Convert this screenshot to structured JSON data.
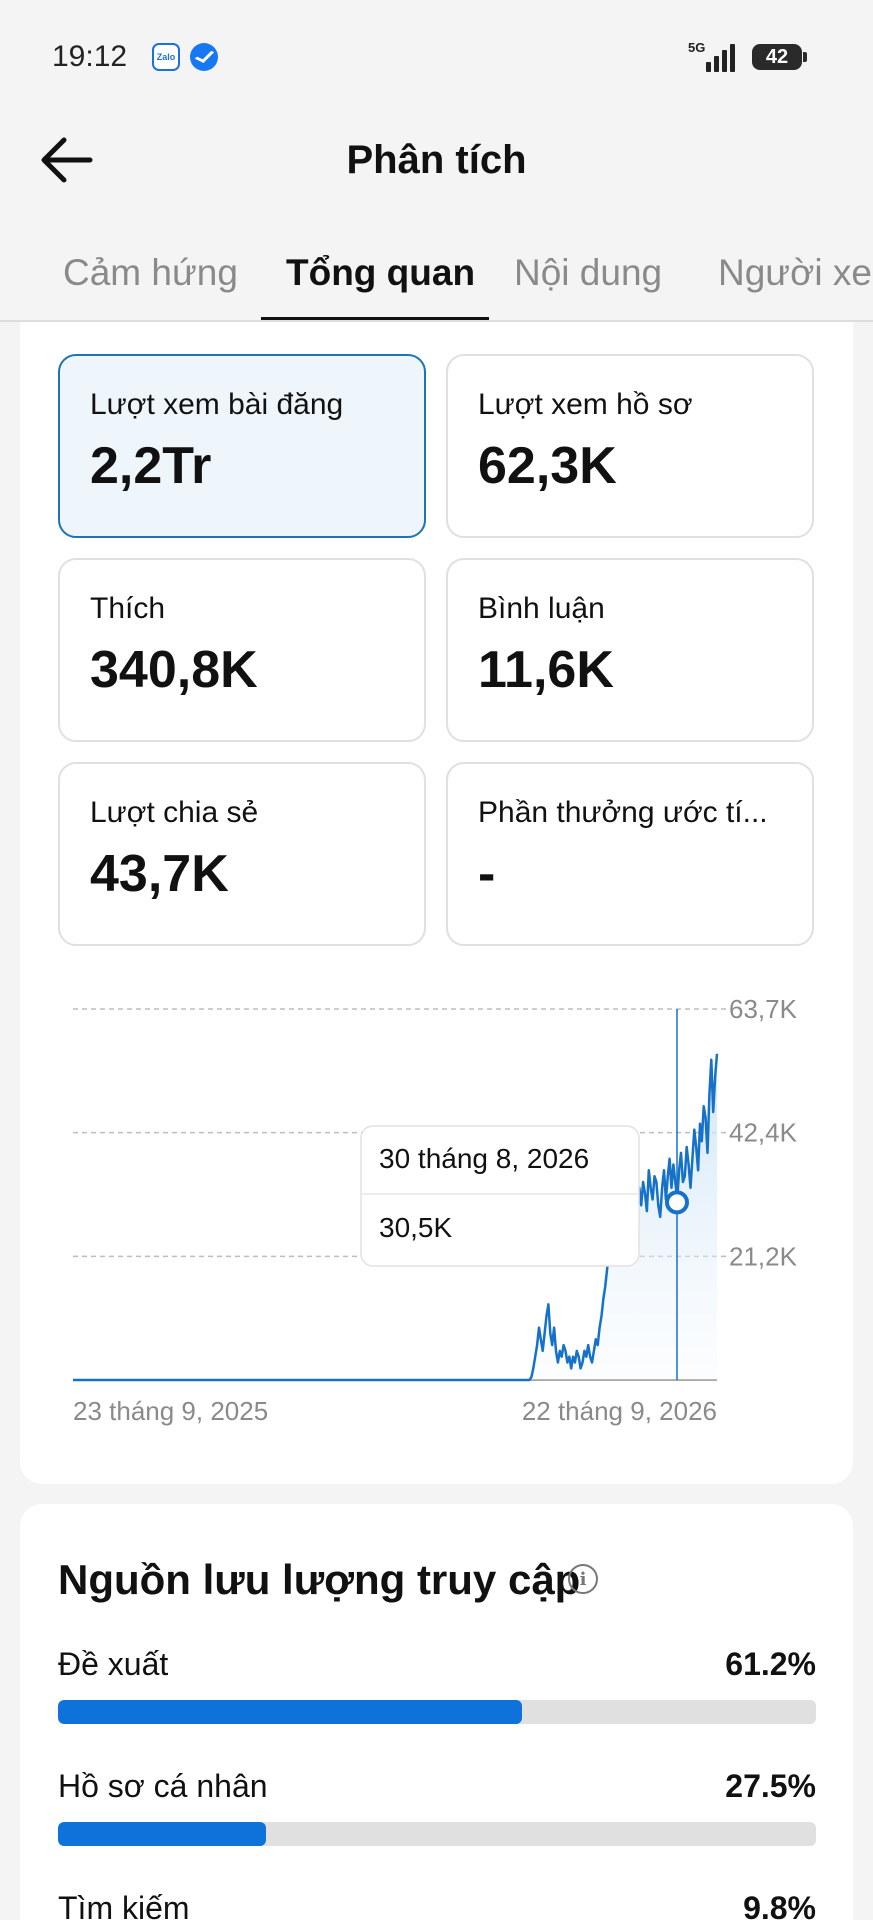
{
  "status_bar": {
    "time": "19:12",
    "zalo_label": "Zalo",
    "network": "5G",
    "battery": "42"
  },
  "header": {
    "title": "Phân tích"
  },
  "tabs": [
    {
      "label": "Cảm hứng",
      "active": false
    },
    {
      "label": "Tổng quan",
      "active": true
    },
    {
      "label": "Nội dung",
      "active": false
    },
    {
      "label": "Người xem",
      "active": false
    }
  ],
  "metrics": [
    {
      "label": "Lượt xem bài đăng",
      "value": "2,2Tr",
      "selected": true
    },
    {
      "label": "Lượt xem hồ sơ",
      "value": "62,3K",
      "selected": false
    },
    {
      "label": "Thích",
      "value": "340,8K",
      "selected": false
    },
    {
      "label": "Bình luận",
      "value": "11,6K",
      "selected": false
    },
    {
      "label": "Lượt chia sẻ",
      "value": "43,7K",
      "selected": false
    },
    {
      "label": "Phần thưởng ước tí...",
      "value": "-",
      "selected": false
    }
  ],
  "chart_data": {
    "type": "line",
    "x_start_label": "23 tháng 9, 2025",
    "x_end_label": "22 tháng 9, 2026",
    "y_ticks": [
      "63,7K",
      "42,4K",
      "21,2K"
    ],
    "y_max": 63.7,
    "tooltip": {
      "date": "30 tháng 8, 2026",
      "value": "30,5K"
    },
    "series_color": "#1672c8",
    "values": [
      0,
      0,
      0,
      0,
      0,
      0,
      0,
      0,
      0,
      0,
      0,
      0,
      0,
      0,
      0,
      0,
      0,
      0,
      0,
      0,
      0,
      0,
      0,
      0,
      0,
      0,
      0,
      0,
      0,
      0,
      0,
      0,
      0,
      0,
      0,
      0,
      0,
      0,
      0,
      0,
      0,
      0,
      0,
      0,
      0,
      0,
      0,
      0,
      0,
      0,
      0,
      0,
      0,
      0,
      0,
      0,
      0,
      0,
      0,
      0,
      0,
      0,
      0,
      0,
      0,
      0,
      0,
      0,
      0,
      0,
      0,
      0,
      0,
      0,
      0,
      0,
      0,
      0,
      0,
      0,
      0,
      0,
      0,
      0,
      0,
      0,
      0,
      0,
      0,
      0,
      0,
      0,
      0,
      0,
      0,
      0,
      0,
      0,
      0,
      0,
      0,
      0,
      0,
      0,
      0,
      0,
      0,
      0,
      0,
      0,
      0,
      0,
      0,
      0,
      0,
      0,
      0,
      0,
      0,
      0,
      0,
      0,
      0,
      0,
      0,
      0,
      0,
      0,
      0,
      0,
      0,
      0,
      0,
      0,
      0,
      0,
      0,
      0,
      0,
      0,
      0,
      0,
      0,
      0,
      0,
      0,
      0,
      0,
      0,
      0,
      0,
      0,
      0,
      0,
      0,
      0,
      0,
      0,
      0,
      0,
      0,
      0,
      0,
      0,
      0,
      0,
      0,
      0,
      0,
      0,
      0,
      0,
      0,
      0,
      0,
      0,
      0,
      0,
      0,
      0,
      0,
      0,
      0,
      0,
      0,
      0,
      0,
      0,
      0,
      0,
      0,
      0,
      0,
      0,
      0,
      0,
      0,
      0,
      0,
      0,
      0,
      0,
      0,
      0,
      0,
      0,
      0,
      0,
      0,
      0,
      0,
      0,
      0,
      0,
      0,
      0,
      0,
      0,
      0,
      0,
      0,
      0,
      0,
      0,
      0,
      0,
      0,
      0,
      0,
      0,
      0,
      0,
      0,
      0,
      0,
      0,
      0,
      0,
      0,
      0,
      0,
      0,
      0.5,
      2,
      4,
      6,
      9,
      7,
      5,
      8,
      11,
      13,
      8,
      6,
      9,
      5,
      3,
      5,
      4,
      6,
      5,
      3,
      4,
      2,
      4,
      3,
      5,
      4,
      2,
      3,
      5,
      4,
      6,
      4,
      3,
      5,
      7,
      6,
      9,
      11,
      14,
      16,
      19,
      22,
      21,
      24,
      26,
      23,
      27,
      25,
      28,
      24,
      26,
      29,
      28,
      27,
      30,
      31,
      27,
      33,
      30,
      34,
      32,
      29,
      36,
      33,
      31,
      35,
      34,
      30,
      28,
      33,
      36,
      31,
      35,
      38,
      33,
      37,
      34,
      31,
      36,
      39,
      34,
      35,
      40,
      37,
      33,
      38,
      43,
      40,
      36,
      44,
      41,
      47,
      45,
      39,
      49,
      55,
      46,
      52,
      56
    ]
  },
  "traffic": {
    "title": "Nguồn lưu lượng truy cập",
    "info_icon": "i",
    "sources": [
      {
        "name": "Đề xuất",
        "percent": "61.2%",
        "fraction": 0.612
      },
      {
        "name": "Hồ sơ cá nhân",
        "percent": "27.5%",
        "fraction": 0.275
      },
      {
        "name": "Tìm kiếm",
        "percent": "9.8%",
        "fraction": 0.098
      }
    ]
  }
}
